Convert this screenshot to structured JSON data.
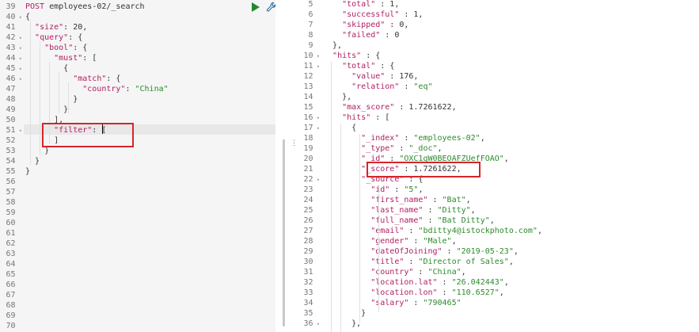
{
  "request": {
    "method": "POST",
    "url": "employees-02/_search",
    "lines": [
      {
        "n": "39",
        "fold": false,
        "parts": [
          [
            "method",
            "POST"
          ],
          [
            "url",
            " employees-02/_search"
          ]
        ]
      },
      {
        "n": "40",
        "fold": true,
        "parts": [
          [
            "p",
            "{"
          ]
        ]
      },
      {
        "n": "41",
        "fold": false,
        "parts": [
          [
            "p",
            "  "
          ],
          [
            "k",
            "\"size\""
          ],
          [
            "p",
            ": 20,"
          ]
        ]
      },
      {
        "n": "42",
        "fold": true,
        "parts": [
          [
            "p",
            "  "
          ],
          [
            "k",
            "\"query\""
          ],
          [
            "p",
            ": {"
          ]
        ]
      },
      {
        "n": "43",
        "fold": true,
        "parts": [
          [
            "p",
            "    "
          ],
          [
            "k",
            "\"bool\""
          ],
          [
            "p",
            ": {"
          ]
        ]
      },
      {
        "n": "44",
        "fold": true,
        "parts": [
          [
            "p",
            "      "
          ],
          [
            "k",
            "\"must\""
          ],
          [
            "p",
            ": ["
          ]
        ]
      },
      {
        "n": "45",
        "fold": true,
        "parts": [
          [
            "p",
            "        {"
          ]
        ]
      },
      {
        "n": "46",
        "fold": true,
        "parts": [
          [
            "p",
            "          "
          ],
          [
            "k",
            "\"match\""
          ],
          [
            "p",
            ": {"
          ]
        ]
      },
      {
        "n": "47",
        "fold": false,
        "parts": [
          [
            "p",
            "            "
          ],
          [
            "k",
            "\"country\""
          ],
          [
            "p",
            ": "
          ],
          [
            "s",
            "\"China\""
          ]
        ]
      },
      {
        "n": "48",
        "fold": false,
        "parts": [
          [
            "p",
            "          }"
          ]
        ]
      },
      {
        "n": "49",
        "fold": false,
        "parts": [
          [
            "p",
            "        }"
          ]
        ]
      },
      {
        "n": "50",
        "fold": false,
        "parts": [
          [
            "p",
            "      ],"
          ]
        ]
      },
      {
        "n": "51",
        "fold": true,
        "parts": [
          [
            "p",
            "      "
          ],
          [
            "k",
            "\"filter\""
          ],
          [
            "p",
            ": ["
          ]
        ]
      },
      {
        "n": "52",
        "fold": false,
        "parts": [
          [
            "p",
            "      ]"
          ]
        ]
      },
      {
        "n": "53",
        "fold": false,
        "parts": [
          [
            "p",
            "    }"
          ]
        ]
      },
      {
        "n": "54",
        "fold": false,
        "parts": [
          [
            "p",
            "  }"
          ]
        ]
      },
      {
        "n": "55",
        "fold": false,
        "parts": [
          [
            "p",
            "}"
          ]
        ]
      },
      {
        "n": "56",
        "fold": false,
        "parts": []
      },
      {
        "n": "57",
        "fold": false,
        "parts": []
      },
      {
        "n": "58",
        "fold": false,
        "parts": []
      },
      {
        "n": "59",
        "fold": false,
        "parts": []
      },
      {
        "n": "60",
        "fold": false,
        "parts": []
      },
      {
        "n": "61",
        "fold": false,
        "parts": []
      },
      {
        "n": "62",
        "fold": false,
        "parts": []
      },
      {
        "n": "63",
        "fold": false,
        "parts": []
      },
      {
        "n": "64",
        "fold": false,
        "parts": []
      },
      {
        "n": "65",
        "fold": false,
        "parts": []
      },
      {
        "n": "66",
        "fold": false,
        "parts": []
      },
      {
        "n": "67",
        "fold": false,
        "parts": []
      },
      {
        "n": "68",
        "fold": false,
        "parts": []
      },
      {
        "n": "69",
        "fold": false,
        "parts": []
      },
      {
        "n": "70",
        "fold": false,
        "parts": []
      }
    ]
  },
  "response": {
    "lines": [
      {
        "n": "5",
        "fold": false,
        "parts": [
          [
            "p",
            "    "
          ],
          [
            "k",
            "\"total\""
          ],
          [
            "p",
            " : 1,"
          ]
        ]
      },
      {
        "n": "6",
        "fold": false,
        "parts": [
          [
            "p",
            "    "
          ],
          [
            "k",
            "\"successful\""
          ],
          [
            "p",
            " : 1,"
          ]
        ]
      },
      {
        "n": "7",
        "fold": false,
        "parts": [
          [
            "p",
            "    "
          ],
          [
            "k",
            "\"skipped\""
          ],
          [
            "p",
            " : 0,"
          ]
        ]
      },
      {
        "n": "8",
        "fold": false,
        "parts": [
          [
            "p",
            "    "
          ],
          [
            "k",
            "\"failed\""
          ],
          [
            "p",
            " : 0"
          ]
        ]
      },
      {
        "n": "9",
        "fold": false,
        "parts": [
          [
            "p",
            "  },"
          ]
        ]
      },
      {
        "n": "10",
        "fold": true,
        "parts": [
          [
            "p",
            "  "
          ],
          [
            "k",
            "\"hits\""
          ],
          [
            "p",
            " : {"
          ]
        ]
      },
      {
        "n": "11",
        "fold": true,
        "parts": [
          [
            "p",
            "    "
          ],
          [
            "k",
            "\"total\""
          ],
          [
            "p",
            " : {"
          ]
        ]
      },
      {
        "n": "12",
        "fold": false,
        "parts": [
          [
            "p",
            "      "
          ],
          [
            "k",
            "\"value\""
          ],
          [
            "p",
            " : 176,"
          ]
        ]
      },
      {
        "n": "13",
        "fold": false,
        "parts": [
          [
            "p",
            "      "
          ],
          [
            "k",
            "\"relation\""
          ],
          [
            "p",
            " : "
          ],
          [
            "s",
            "\"eq\""
          ]
        ]
      },
      {
        "n": "14",
        "fold": false,
        "parts": [
          [
            "p",
            "    },"
          ]
        ]
      },
      {
        "n": "15",
        "fold": false,
        "parts": [
          [
            "p",
            "    "
          ],
          [
            "k",
            "\"max_score\""
          ],
          [
            "p",
            " : 1.7261622,"
          ]
        ]
      },
      {
        "n": "16",
        "fold": true,
        "parts": [
          [
            "p",
            "    "
          ],
          [
            "k",
            "\"hits\""
          ],
          [
            "p",
            " : ["
          ]
        ]
      },
      {
        "n": "17",
        "fold": true,
        "parts": [
          [
            "p",
            "      {"
          ]
        ]
      },
      {
        "n": "18",
        "fold": false,
        "parts": [
          [
            "p",
            "        "
          ],
          [
            "k",
            "\"_index\""
          ],
          [
            "p",
            " : "
          ],
          [
            "s",
            "\"employees-02\""
          ],
          [
            "p",
            ","
          ]
        ]
      },
      {
        "n": "19",
        "fold": false,
        "parts": [
          [
            "p",
            "        "
          ],
          [
            "k",
            "\"_type\""
          ],
          [
            "p",
            " : "
          ],
          [
            "s",
            "\"_doc\""
          ],
          [
            "p",
            ","
          ]
        ]
      },
      {
        "n": "20",
        "fold": false,
        "parts": [
          [
            "p",
            "        "
          ],
          [
            "k",
            "\"_id\""
          ],
          [
            "p",
            " : "
          ],
          [
            "s",
            "\"OXC1gW0BEOAFZUefFOAO\""
          ],
          [
            "p",
            ","
          ]
        ]
      },
      {
        "n": "21",
        "fold": false,
        "parts": [
          [
            "p",
            "        "
          ],
          [
            "k",
            "\"_score\""
          ],
          [
            "p",
            " : 1.7261622,"
          ]
        ]
      },
      {
        "n": "22",
        "fold": true,
        "parts": [
          [
            "p",
            "        "
          ],
          [
            "k",
            "\"_source\""
          ],
          [
            "p",
            " : {"
          ]
        ]
      },
      {
        "n": "23",
        "fold": false,
        "parts": [
          [
            "p",
            "          "
          ],
          [
            "k",
            "\"id\""
          ],
          [
            "p",
            " : "
          ],
          [
            "s",
            "\"5\""
          ],
          [
            "p",
            ","
          ]
        ]
      },
      {
        "n": "24",
        "fold": false,
        "parts": [
          [
            "p",
            "          "
          ],
          [
            "k",
            "\"first_name\""
          ],
          [
            "p",
            " : "
          ],
          [
            "s",
            "\"Bat\""
          ],
          [
            "p",
            ","
          ]
        ]
      },
      {
        "n": "25",
        "fold": false,
        "parts": [
          [
            "p",
            "          "
          ],
          [
            "k",
            "\"last_name\""
          ],
          [
            "p",
            " : "
          ],
          [
            "s",
            "\"Ditty\""
          ],
          [
            "p",
            ","
          ]
        ]
      },
      {
        "n": "26",
        "fold": false,
        "parts": [
          [
            "p",
            "          "
          ],
          [
            "k",
            "\"full_name\""
          ],
          [
            "p",
            " : "
          ],
          [
            "s",
            "\"Bat Ditty\""
          ],
          [
            "p",
            ","
          ]
        ]
      },
      {
        "n": "27",
        "fold": false,
        "parts": [
          [
            "p",
            "          "
          ],
          [
            "k",
            "\"email\""
          ],
          [
            "p",
            " : "
          ],
          [
            "s",
            "\"bditty4@istockphoto.com\""
          ],
          [
            "p",
            ","
          ]
        ]
      },
      {
        "n": "28",
        "fold": false,
        "parts": [
          [
            "p",
            "          "
          ],
          [
            "k",
            "\"gender\""
          ],
          [
            "p",
            " : "
          ],
          [
            "s",
            "\"Male\""
          ],
          [
            "p",
            ","
          ]
        ]
      },
      {
        "n": "29",
        "fold": false,
        "parts": [
          [
            "p",
            "          "
          ],
          [
            "k",
            "\"dateOfJoining\""
          ],
          [
            "p",
            " : "
          ],
          [
            "s",
            "\"2019-05-23\""
          ],
          [
            "p",
            ","
          ]
        ]
      },
      {
        "n": "30",
        "fold": false,
        "parts": [
          [
            "p",
            "          "
          ],
          [
            "k",
            "\"title\""
          ],
          [
            "p",
            " : "
          ],
          [
            "s",
            "\"Director of Sales\""
          ],
          [
            "p",
            ","
          ]
        ]
      },
      {
        "n": "31",
        "fold": false,
        "parts": [
          [
            "p",
            "          "
          ],
          [
            "k",
            "\"country\""
          ],
          [
            "p",
            " : "
          ],
          [
            "s",
            "\"China\""
          ],
          [
            "p",
            ","
          ]
        ]
      },
      {
        "n": "32",
        "fold": false,
        "parts": [
          [
            "p",
            "          "
          ],
          [
            "k",
            "\"location.lat\""
          ],
          [
            "p",
            " : "
          ],
          [
            "s",
            "\"26.042443\""
          ],
          [
            "p",
            ","
          ]
        ]
      },
      {
        "n": "33",
        "fold": false,
        "parts": [
          [
            "p",
            "          "
          ],
          [
            "k",
            "\"location.lon\""
          ],
          [
            "p",
            " : "
          ],
          [
            "s",
            "\"110.6527\""
          ],
          [
            "p",
            ","
          ]
        ]
      },
      {
        "n": "34",
        "fold": false,
        "parts": [
          [
            "p",
            "          "
          ],
          [
            "k",
            "\"salary\""
          ],
          [
            "p",
            " : "
          ],
          [
            "s",
            "\"790465\""
          ]
        ]
      },
      {
        "n": "35",
        "fold": false,
        "parts": [
          [
            "p",
            "        }"
          ]
        ]
      },
      {
        "n": "36",
        "fold": true,
        "parts": [
          [
            "p",
            "      },"
          ]
        ]
      }
    ]
  },
  "icons": {
    "run": "play-icon",
    "settings": "wrench-icon",
    "resize": "vertical-dots-icon"
  },
  "colors": {
    "key": "#b02064",
    "string": "#2c8a2c",
    "highlight_box": "#d6252a",
    "run_button": "#1f8a2c"
  }
}
